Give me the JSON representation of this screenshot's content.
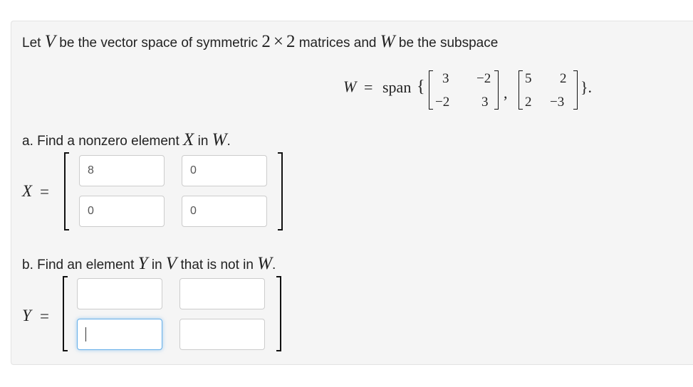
{
  "problem": {
    "intro": [
      "Let ",
      "V",
      " be the vector space of symmetric ",
      "2",
      "×",
      "2",
      " matrices and ",
      "W",
      " be the subspace"
    ],
    "span": {
      "lhs": "W",
      "eq": "=",
      "func": "span",
      "open_brace": "{",
      "close_brace": "}.",
      "comma": ",",
      "matrix1": [
        "3",
        "−2",
        "−2",
        "3"
      ],
      "matrix2": [
        "5",
        "2",
        "2",
        "−3"
      ]
    }
  },
  "part_a": {
    "prompt": [
      "a. Find a nonzero element ",
      "X",
      " in ",
      "W",
      "."
    ],
    "lhs": "X",
    "eq": "=",
    "values": [
      "8",
      "0",
      "0",
      "0"
    ]
  },
  "part_b": {
    "prompt": [
      "b. Find an element ",
      "Y",
      " in ",
      "V",
      " that is not in ",
      "W",
      "."
    ],
    "lhs": "Y",
    "eq": "=",
    "values": [
      "",
      "",
      "",
      ""
    ],
    "focused_index": 2
  }
}
